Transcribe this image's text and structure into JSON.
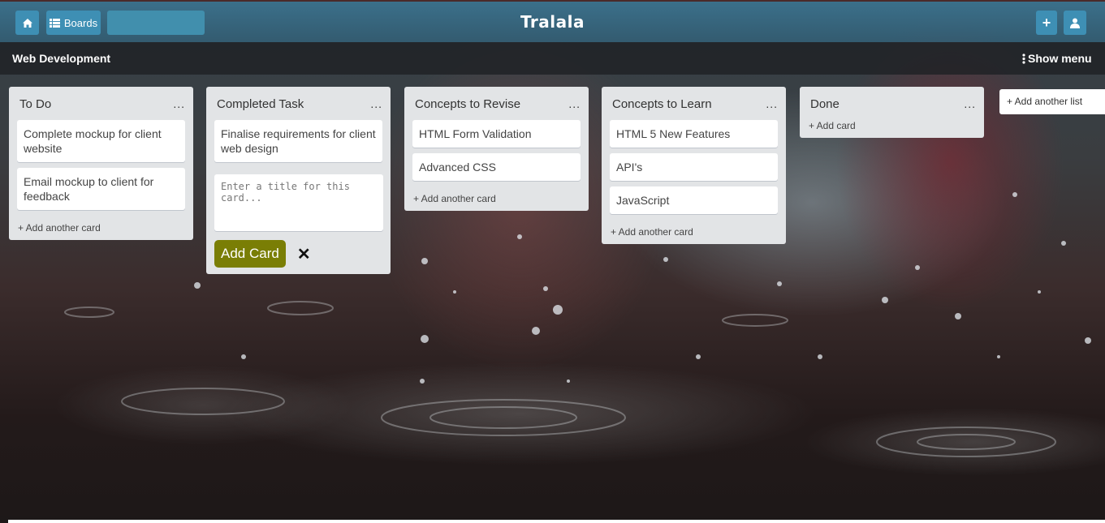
{
  "header": {
    "app_title": "Tralala",
    "boards_label": "Boards",
    "add_label": "+",
    "icons": [
      "home-icon",
      "boards-list-icon",
      "plus-icon",
      "user-icon"
    ]
  },
  "board": {
    "name": "Web Development",
    "show_menu_label": "Show menu"
  },
  "lists": [
    {
      "title": "To Do",
      "more": "...",
      "cards": [
        "Complete mockup for client website",
        "Email mockup to client for feedback"
      ],
      "add_label": "+ Add another card"
    },
    {
      "title": "Completed Task",
      "more": "...",
      "cards": [
        "Finalise requirements for client web design"
      ],
      "composer": {
        "placeholder": "Enter a title for this card...",
        "submit_label": "Add Card",
        "close_label": "✕"
      }
    },
    {
      "title": "Concepts to Revise",
      "more": "...",
      "cards": [
        "HTML Form Validation",
        "Advanced CSS"
      ],
      "add_label": "+ Add another card"
    },
    {
      "title": "Concepts to Learn",
      "more": "...",
      "cards": [
        "HTML 5 New Features",
        "API's",
        "JavaScript"
      ],
      "add_label": "+ Add another card"
    },
    {
      "title": "Done",
      "more": "...",
      "cards": [],
      "add_label": "+ Add card"
    }
  ],
  "add_list_label": "+ Add another list",
  "colors": {
    "topbar": "#3e8fb4",
    "list_bg": "#e2e4e6",
    "add_card_button": "#7a7e05"
  }
}
